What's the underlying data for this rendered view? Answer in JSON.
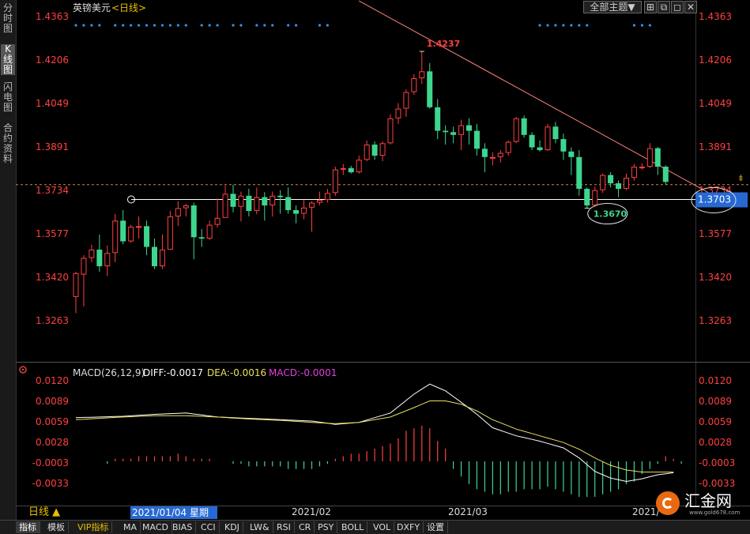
{
  "left_tabs": [
    "分时图",
    "K线图",
    "闪电图",
    "合约资料"
  ],
  "left_tab_active": 1,
  "title": {
    "name": "英镑美元",
    "period": "<日线>"
  },
  "top_controls": {
    "theme_select": "全部主题▼"
  },
  "price_ticks": [
    "1.4363",
    "1.4206",
    "1.4049",
    "1.3891",
    "1.3734",
    "1.3577",
    "1.3420",
    "1.3263"
  ],
  "high_label": "1.4237",
  "low_label": "1.3670",
  "current_price_label": "1.3703",
  "macd": {
    "header": "MACD(26,12,9)",
    "diff": "DIFF:-0.0017",
    "dea": "DEA:-0.0016",
    "macd": "MACD:-0.0001",
    "ticks": [
      "0.0120",
      "0.0089",
      "0.0059",
      "0.0028",
      "-0.0003",
      "-0.0033"
    ]
  },
  "x_labels": [
    "2021/02",
    "2021/03",
    "2021/"
  ],
  "date_box": "2021/01/04 星期一",
  "period_button": "日线 ▲",
  "bottom_tabs": [
    "指标",
    "模板",
    "VIP指标",
    "MA",
    "MACD",
    "BIAS",
    "CCI",
    "KDJ",
    "LW&",
    "RSI",
    "CR",
    "PSY",
    "BOLL",
    "VOL",
    "DXFY",
    "设置"
  ],
  "logo": {
    "name": "汇金网",
    "url": "www.gold678.com"
  },
  "colors": {
    "up": "#ff4040",
    "down": "#3ed68f",
    "diff": "#ffffff",
    "dea": "#e8e060",
    "macd_label": "#e040e0",
    "trend": "#ff8080",
    "dot": "#3b8ef0",
    "current": "#2769d4",
    "axis_text": "#ff4040"
  },
  "chart_data": {
    "type": "candlestick",
    "title": "英镑美元",
    "x_start": "2021/01/04",
    "y_range": [
      1.3185,
      1.4442
    ],
    "candles": [
      [
        1.3349,
        1.3435,
        1.329,
        1.344
      ],
      [
        1.343,
        1.349,
        1.3315,
        1.35
      ],
      [
        1.349,
        1.352,
        1.3475,
        1.3538
      ],
      [
        1.352,
        1.346,
        1.344,
        1.3575
      ],
      [
        1.346,
        1.3508,
        1.3425,
        1.3535
      ],
      [
        1.3508,
        1.3625,
        1.3475,
        1.365
      ],
      [
        1.3625,
        1.355,
        1.354,
        1.3663
      ],
      [
        1.355,
        1.3603,
        1.3545,
        1.361
      ],
      [
        1.3603,
        1.3605,
        1.356,
        1.364
      ],
      [
        1.3605,
        1.353,
        1.35,
        1.3625
      ],
      [
        1.353,
        1.346,
        1.345,
        1.356
      ],
      [
        1.346,
        1.352,
        1.345,
        1.3575
      ],
      [
        1.352,
        1.364,
        1.352,
        1.366
      ],
      [
        1.364,
        1.367,
        1.3605,
        1.3695
      ],
      [
        1.367,
        1.368,
        1.364,
        1.3685
      ],
      [
        1.368,
        1.3565,
        1.3485,
        1.369
      ],
      [
        1.3565,
        1.356,
        1.353,
        1.3595
      ],
      [
        1.356,
        1.361,
        1.3555,
        1.3625
      ],
      [
        1.361,
        1.3635,
        1.36,
        1.3705
      ],
      [
        1.3635,
        1.3722,
        1.3635,
        1.3752
      ],
      [
        1.3722,
        1.3675,
        1.3655,
        1.3755
      ],
      [
        1.3675,
        1.3715,
        1.3622,
        1.373
      ],
      [
        1.3715,
        1.366,
        1.364,
        1.374
      ],
      [
        1.366,
        1.371,
        1.3648,
        1.3745
      ],
      [
        1.371,
        1.368,
        1.3625,
        1.3728
      ],
      [
        1.368,
        1.3715,
        1.364,
        1.373
      ],
      [
        1.3715,
        1.371,
        1.365,
        1.3735
      ],
      [
        1.371,
        1.3663,
        1.365,
        1.3745
      ],
      [
        1.3663,
        1.365,
        1.3615,
        1.368
      ],
      [
        1.365,
        1.3672,
        1.363,
        1.37
      ],
      [
        1.3672,
        1.369,
        1.3585,
        1.3695
      ],
      [
        1.369,
        1.37,
        1.368,
        1.373
      ],
      [
        1.37,
        1.3725,
        1.369,
        1.374
      ],
      [
        1.3725,
        1.381,
        1.3715,
        1.382
      ],
      [
        1.381,
        1.3815,
        1.379,
        1.383
      ],
      [
        1.3815,
        1.38,
        1.3795,
        1.3823
      ],
      [
        1.38,
        1.3845,
        1.3795,
        1.386
      ],
      [
        1.3845,
        1.39,
        1.384,
        1.3915
      ],
      [
        1.39,
        1.386,
        1.3845,
        1.3912
      ],
      [
        1.386,
        1.3905,
        1.384,
        1.3912
      ],
      [
        1.3905,
        1.3995,
        1.39,
        1.401
      ],
      [
        1.3995,
        1.403,
        1.3975,
        1.405
      ],
      [
        1.403,
        1.409,
        1.4,
        1.41
      ],
      [
        1.409,
        1.414,
        1.408,
        1.4155
      ],
      [
        1.414,
        1.4165,
        1.412,
        1.4237
      ],
      [
        1.4165,
        1.4035,
        1.403,
        1.4195
      ],
      [
        1.4035,
        1.395,
        1.392,
        1.4065
      ],
      [
        1.395,
        1.3945,
        1.39,
        1.397
      ],
      [
        1.3945,
        1.3935,
        1.3905,
        1.3965
      ],
      [
        1.3935,
        1.397,
        1.388,
        1.399
      ],
      [
        1.397,
        1.395,
        1.39,
        1.3995
      ],
      [
        1.395,
        1.3885,
        1.386,
        1.3975
      ],
      [
        1.3885,
        1.3855,
        1.38,
        1.3905
      ],
      [
        1.3855,
        1.3855,
        1.3825,
        1.3872
      ],
      [
        1.3855,
        1.387,
        1.3835,
        1.388
      ],
      [
        1.387,
        1.391,
        1.386,
        1.3915
      ],
      [
        1.391,
        1.3995,
        1.3905,
        1.4
      ],
      [
        1.3995,
        1.3935,
        1.3925,
        1.4005
      ],
      [
        1.3935,
        1.389,
        1.388,
        1.3945
      ],
      [
        1.389,
        1.388,
        1.3875,
        1.3915
      ],
      [
        1.388,
        1.3965,
        1.3878,
        1.3975
      ],
      [
        1.3965,
        1.392,
        1.3905,
        1.3982
      ],
      [
        1.392,
        1.3875,
        1.3845,
        1.394
      ],
      [
        1.3875,
        1.3855,
        1.379,
        1.389
      ],
      [
        1.3855,
        1.374,
        1.3715,
        1.388
      ],
      [
        1.374,
        1.368,
        1.367,
        1.3745
      ],
      [
        1.368,
        1.3735,
        1.3675,
        1.3748
      ],
      [
        1.3735,
        1.379,
        1.3725,
        1.3795
      ],
      [
        1.379,
        1.376,
        1.3745,
        1.38
      ],
      [
        1.376,
        1.374,
        1.371,
        1.377
      ],
      [
        1.374,
        1.378,
        1.3735,
        1.3795
      ],
      [
        1.378,
        1.382,
        1.377,
        1.383
      ],
      [
        1.382,
        1.382,
        1.381,
        1.3832
      ],
      [
        1.382,
        1.3887,
        1.3815,
        1.3905
      ],
      [
        1.3887,
        1.382,
        1.379,
        1.3892
      ],
      [
        1.382,
        1.3765,
        1.3755,
        1.3825
      ]
    ],
    "high_point": {
      "index": 44,
      "value": 1.4237
    },
    "low_point": {
      "index": 65,
      "value": 1.367
    },
    "support_level": 1.3703,
    "dashed_level": 1.3755,
    "trendline": [
      [
        36,
        1.442
      ],
      [
        82,
        1.3702
      ]
    ],
    "macd_ylim": [
      -0.006,
      0.014
    ],
    "macd_diff_anchors": [
      [
        0,
        0.0065
      ],
      [
        6,
        0.0067
      ],
      [
        10,
        0.007
      ],
      [
        14,
        0.0072
      ],
      [
        18,
        0.0066
      ],
      [
        22,
        0.0064
      ],
      [
        26,
        0.0062
      ],
      [
        30,
        0.006
      ],
      [
        33,
        0.0055
      ],
      [
        36,
        0.0058
      ],
      [
        40,
        0.0072
      ],
      [
        43,
        0.01
      ],
      [
        45,
        0.0115
      ],
      [
        47,
        0.0105
      ],
      [
        49,
        0.0088
      ],
      [
        51,
        0.007
      ],
      [
        53,
        0.005
      ],
      [
        56,
        0.0038
      ],
      [
        59,
        0.003
      ],
      [
        62,
        0.002
      ],
      [
        64,
        0.0005
      ],
      [
        66,
        -0.0015
      ],
      [
        68,
        -0.0025
      ],
      [
        70,
        -0.003
      ],
      [
        72,
        -0.0026
      ],
      [
        74,
        -0.002
      ],
      [
        76,
        -0.0017
      ]
    ],
    "macd_dea_anchors": [
      [
        0,
        0.0062
      ],
      [
        6,
        0.0066
      ],
      [
        10,
        0.0068
      ],
      [
        14,
        0.0068
      ],
      [
        18,
        0.0066
      ],
      [
        22,
        0.0063
      ],
      [
        26,
        0.0061
      ],
      [
        30,
        0.0058
      ],
      [
        33,
        0.0056
      ],
      [
        36,
        0.0058
      ],
      [
        40,
        0.0066
      ],
      [
        43,
        0.008
      ],
      [
        45,
        0.009
      ],
      [
        47,
        0.009
      ],
      [
        49,
        0.0085
      ],
      [
        51,
        0.0075
      ],
      [
        53,
        0.0062
      ],
      [
        56,
        0.0048
      ],
      [
        59,
        0.0038
      ],
      [
        62,
        0.0028
      ],
      [
        64,
        0.0018
      ],
      [
        66,
        0.0005
      ],
      [
        68,
        -0.0006
      ],
      [
        70,
        -0.0013
      ],
      [
        72,
        -0.0016
      ],
      [
        74,
        -0.0016
      ],
      [
        76,
        -0.0016
      ]
    ],
    "macd_hist": [
      0.0,
      0.0,
      0.0,
      0.0,
      -0.0001,
      0.0001,
      0.0001,
      0.0001,
      0.0002,
      0.0002,
      0.0002,
      0.0002,
      0.0002,
      0.0003,
      0.0002,
      0.0001,
      0.0001,
      0.0001,
      0.0,
      0.0,
      -0.0001,
      -0.0001,
      -0.0002,
      -0.0002,
      -0.0002,
      -0.0002,
      -0.0002,
      -0.0003,
      -0.0003,
      -0.0003,
      -0.0003,
      -0.0002,
      -0.0001,
      0.0001,
      0.0002,
      0.0003,
      0.0003,
      0.0004,
      0.0005,
      0.0006,
      0.0007,
      0.0009,
      0.0012,
      0.0013,
      0.0014,
      0.0013,
      0.0008,
      0.0005,
      -0.0003,
      -0.0006,
      -0.0009,
      -0.0011,
      -0.0012,
      -0.0013,
      -0.0013,
      -0.0012,
      -0.0012,
      -0.0011,
      -0.0011,
      -0.0011,
      -0.001,
      -0.0011,
      -0.0012,
      -0.0013,
      -0.0014,
      -0.0014,
      -0.0014,
      -0.0013,
      -0.0012,
      -0.0011,
      -0.0009,
      -0.0008,
      -0.0005,
      -0.0003,
      -0.0001,
      0.0002,
      0.0001,
      -0.0001
    ]
  }
}
